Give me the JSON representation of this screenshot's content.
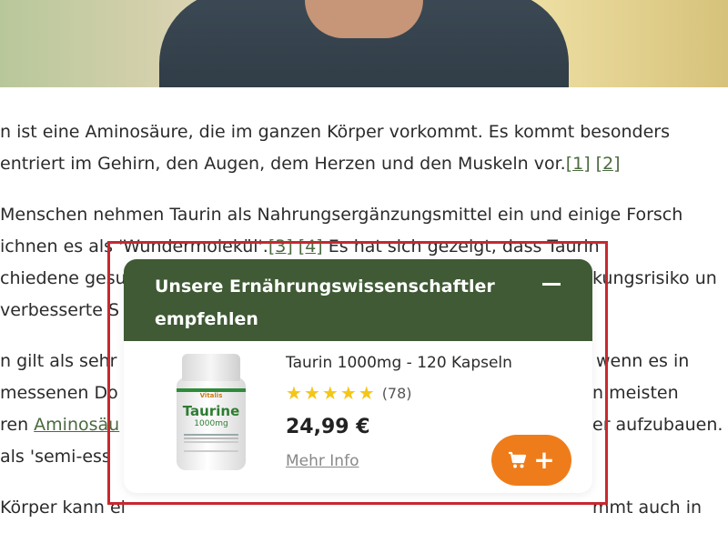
{
  "article": {
    "p1": [
      "n ist eine Aminosäure, die im ganzen Körper vorkommt. Es kommt besonders",
      "entriert im Gehirn, den Augen, dem Herzen und den Muskeln vor."
    ],
    "p1_refs": [
      "[1]",
      "[2]"
    ],
    "p2": [
      " Menschen nehmen Taurin als Nahrungsergänzungsmittel ein und einige Forsch",
      "ichnen es als 'Wundermolekül'.",
      " Es hat sich gezeigt, dass Taurin",
      "chiedene gesu",
      "kungsrisiko un",
      "verbesserte S"
    ],
    "p2_refs": [
      "[3]",
      "[4]"
    ],
    "p3": [
      "n gilt als sehr",
      "wenn es in",
      "messenen Do",
      "n meisten",
      "ren ",
      "er aufzubauen.",
      "als 'semi-ess"
    ],
    "p3_link": "Aminosäu",
    "p4": [
      "Körper kann ei",
      "mmt auch in"
    ]
  },
  "widget": {
    "title": "Unsere Ernährungswissenschaftler empfehlen",
    "product": {
      "name": "Taurin 1000mg - 120 Kapseln",
      "rating_stars": 5,
      "reviews": "(78)",
      "price": "24,99 €",
      "more_info": "Mehr Info",
      "bottle_brand": "Vitalis",
      "bottle_label": "Taurine",
      "bottle_sub": "1000mg"
    },
    "cart_icon": "cart-icon",
    "add_icon": "plus-icon"
  },
  "colors": {
    "header_green": "#3f5a34",
    "cart_orange": "#ef7c1a",
    "star_yellow": "#f5c518",
    "highlight_red": "#c8282f",
    "link_green": "#4b6a3f"
  }
}
